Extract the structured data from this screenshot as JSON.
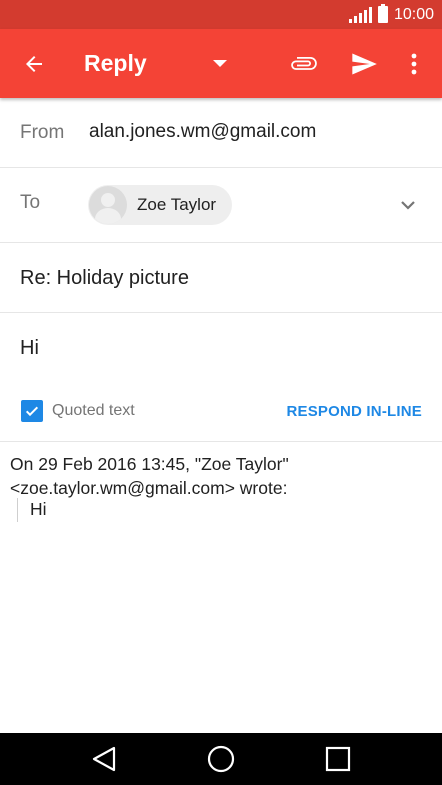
{
  "status_bar": {
    "time": "10:00"
  },
  "app_bar": {
    "title": "Reply",
    "icons": [
      "back-arrow-icon",
      "dropdown-arrow-icon",
      "attach-icon",
      "send-icon",
      "more-vert-icon"
    ],
    "color": "#f44336",
    "status_color": "#d33b2f"
  },
  "from": {
    "label": "From",
    "value": "alan.jones.wm@gmail.com"
  },
  "to": {
    "label": "To",
    "recipient": "Zoe Taylor"
  },
  "subject": "Re: Holiday picture",
  "body": "Hi",
  "quoted": {
    "checked": true,
    "label": "Quoted text",
    "respond_inline": "RESPOND IN-LINE",
    "header": "On 29 Feb 2016 13:45, \"Zoe Taylor\" <zoe.taylor.wm@gmail.com> wrote:",
    "text": "Hi"
  },
  "accent_color": "#1e88e5"
}
